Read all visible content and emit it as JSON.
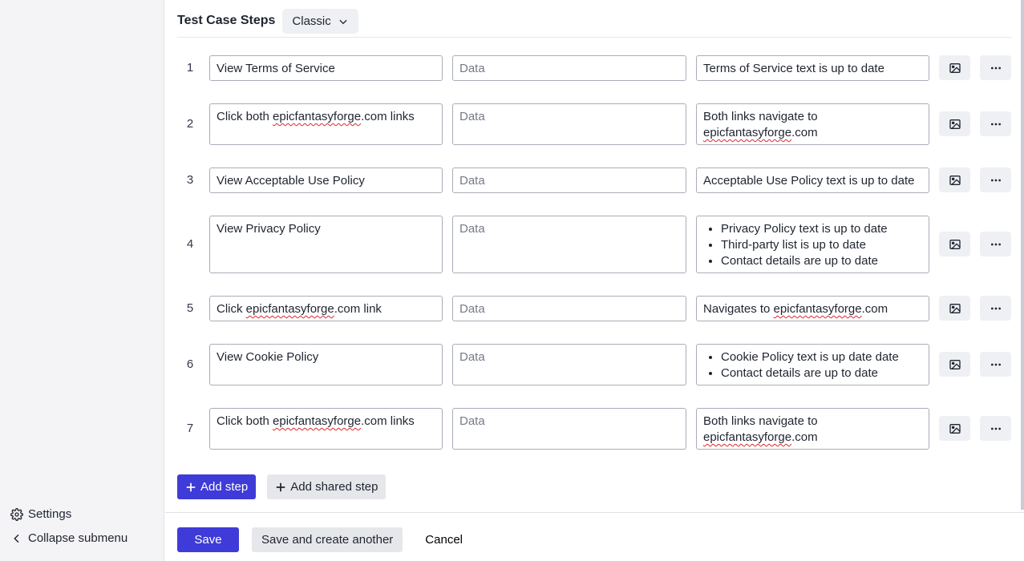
{
  "submenu": {
    "settings_label": "Settings",
    "collapse_label": "Collapse submenu"
  },
  "section": {
    "title": "Test Case Steps",
    "view_mode": "Classic"
  },
  "data_placeholder": "Data",
  "steps": [
    {
      "number": "1",
      "action": "View Terms of Service",
      "expected": "Terms of Service text is up to date"
    },
    {
      "number": "2",
      "action": "Click both epicfantasyforge.com links",
      "expected": "Both links navigate to epicfantasyforge.com"
    },
    {
      "number": "3",
      "action": "View Acceptable Use Policy",
      "expected": "Acceptable Use Policy text is up to date"
    },
    {
      "number": "4",
      "action": "View Privacy Policy",
      "expected_items": [
        "Privacy Policy text is up to date",
        "Third-party list is up to date",
        "Contact details are up to date"
      ]
    },
    {
      "number": "5",
      "action": "Click epicfantasyforge.com link",
      "expected": "Navigates to epicfantasyforge.com"
    },
    {
      "number": "6",
      "action": "View Cookie Policy",
      "expected_items": [
        "Cookie Policy text is up date date",
        "Contact details are up to date"
      ]
    },
    {
      "number": "7",
      "action": "Click both epicfantasyforge.com links",
      "expected": "Both links navigate to epicfantasyforge.com"
    }
  ],
  "actions": {
    "add_step": "Add step",
    "add_shared_step": "Add shared step"
  },
  "footer": {
    "save": "Save",
    "save_and_create": "Save and create another",
    "cancel": "Cancel"
  },
  "colors": {
    "primary": "#3f3bd8",
    "spellcheck": "#e0262b"
  }
}
